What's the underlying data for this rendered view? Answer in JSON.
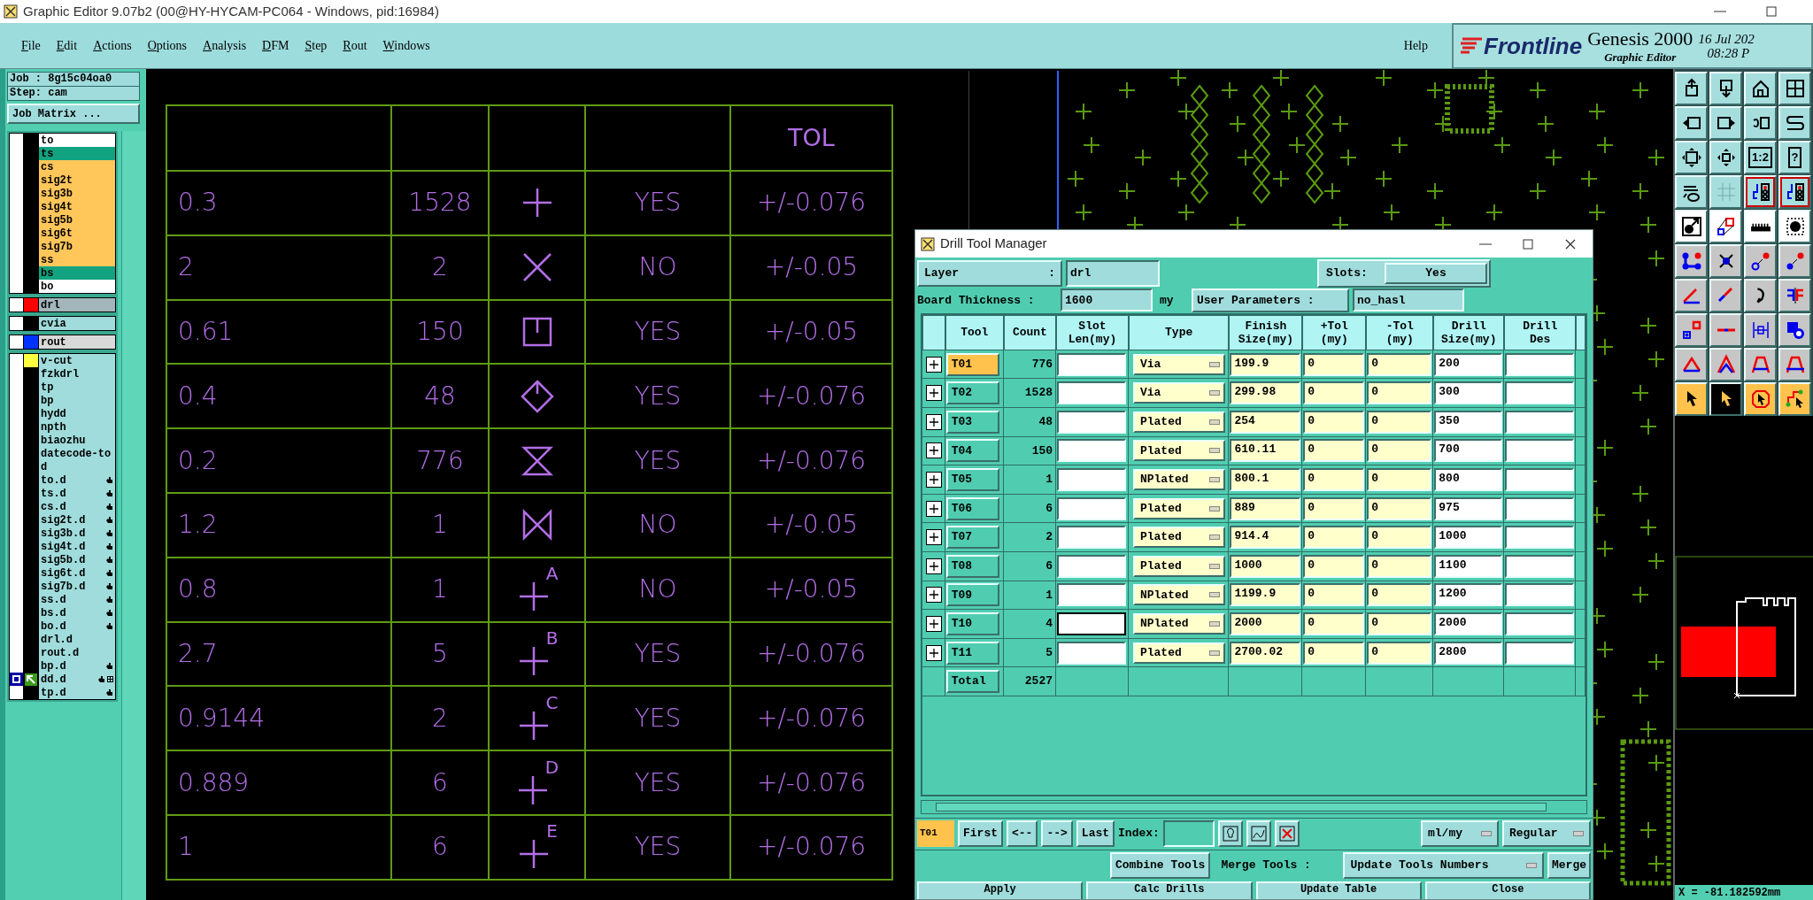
{
  "window": {
    "title": "Graphic Editor 9.07b2 (00@HY-HYCAM-PC064 - Windows, pid:16984)"
  },
  "menu": [
    "File",
    "Edit",
    "Actions",
    "Options",
    "Analysis",
    "DFM",
    "Step",
    "Rout",
    "Windows"
  ],
  "help": "Help",
  "brand": {
    "logo": "Frontline",
    "product": "Genesis 2000",
    "subtitle": "Graphic Editor",
    "date": "16 Jul 202",
    "time": "08:28 P"
  },
  "job": {
    "job": "Job : 8g15c04oa0",
    "step": "Step: cam",
    "matrix_button": "Job Matrix ..."
  },
  "layer_groups": [
    [
      {
        "name": "to",
        "color": "#ffffff",
        "checked": false,
        "marked": false,
        "work": false
      },
      {
        "name": "ts",
        "color": "#11a37f",
        "checked": false,
        "marked": false,
        "work": false
      },
      {
        "name": "cs",
        "color": "#ffc65a",
        "checked": false,
        "marked": false,
        "work": false
      },
      {
        "name": "sig2t",
        "color": "#ffc65a",
        "checked": false,
        "marked": false,
        "work": false
      },
      {
        "name": "sig3b",
        "color": "#ffc65a",
        "checked": false,
        "marked": false,
        "work": false
      },
      {
        "name": "sig4t",
        "color": "#ffc65a",
        "checked": false,
        "marked": false,
        "work": false
      },
      {
        "name": "sig5b",
        "color": "#ffc65a",
        "checked": false,
        "marked": false,
        "work": false
      },
      {
        "name": "sig6t",
        "color": "#ffc65a",
        "checked": false,
        "marked": false,
        "work": false
      },
      {
        "name": "sig7b",
        "color": "#ffc65a",
        "checked": false,
        "marked": false,
        "work": false
      },
      {
        "name": "ss",
        "color": "#ffc65a",
        "checked": false,
        "marked": false,
        "work": false
      },
      {
        "name": "bs",
        "color": "#11a37f",
        "checked": false,
        "marked": false,
        "work": false
      },
      {
        "name": "bo",
        "color": "#ffffff",
        "checked": false,
        "marked": false,
        "work": false
      }
    ],
    [
      {
        "name": "drl",
        "color": "#a3b6bb",
        "swatch": {
          "color": "#ff0000"
        },
        "checked": false,
        "marked": false,
        "work": false
      }
    ],
    [
      {
        "name": "cvia",
        "color": "#a0dcdc",
        "checked": false,
        "marked": false,
        "work": false
      }
    ],
    [
      {
        "name": "rout",
        "color": "#d9d9d9",
        "swatch": {
          "color": "#0033ff"
        },
        "checked": false,
        "marked": false,
        "work": false
      }
    ],
    [
      {
        "name": "v-cut",
        "color": "#a0dcdc",
        "swatch": {
          "color": "#ffff40"
        },
        "checked": false,
        "marked": false,
        "work": false
      },
      {
        "name": "fzkdrl",
        "color": "#a0dcdc",
        "checked": false,
        "marked": false,
        "work": false
      },
      {
        "name": "tp",
        "color": "#a0dcdc",
        "checked": false,
        "marked": false,
        "work": false
      },
      {
        "name": "bp",
        "color": "#a0dcdc",
        "checked": false,
        "marked": false,
        "work": false
      },
      {
        "name": "hydd",
        "color": "#a0dcdc",
        "checked": false,
        "marked": false,
        "work": false
      },
      {
        "name": "npth",
        "color": "#a0dcdc",
        "checked": false,
        "marked": false,
        "work": false
      },
      {
        "name": "biaozhu",
        "color": "#a0dcdc",
        "checked": false,
        "marked": false,
        "work": false
      },
      {
        "name": "datecode-to",
        "color": "#a0dcdc",
        "checked": false,
        "marked": false,
        "work": false
      },
      {
        "name": "d",
        "color": "#a0dcdc",
        "checked": false,
        "marked": false,
        "work": false
      },
      {
        "name": "to.d",
        "color": "#a0dcdc",
        "checked": false,
        "marked": true,
        "work": false
      },
      {
        "name": "ts.d",
        "color": "#a0dcdc",
        "checked": false,
        "marked": true,
        "work": false
      },
      {
        "name": "cs.d",
        "color": "#a0dcdc",
        "checked": false,
        "marked": true,
        "work": false
      },
      {
        "name": "sig2t.d",
        "color": "#a0dcdc",
        "checked": false,
        "marked": true,
        "work": false
      },
      {
        "name": "sig3b.d",
        "color": "#a0dcdc",
        "checked": false,
        "marked": true,
        "work": false
      },
      {
        "name": "sig4t.d",
        "color": "#a0dcdc",
        "checked": false,
        "marked": true,
        "work": false
      },
      {
        "name": "sig5b.d",
        "color": "#a0dcdc",
        "checked": false,
        "marked": true,
        "work": false
      },
      {
        "name": "sig6t.d",
        "color": "#a0dcdc",
        "checked": false,
        "marked": true,
        "work": false
      },
      {
        "name": "sig7b.d",
        "color": "#a0dcdc",
        "checked": false,
        "marked": true,
        "work": false
      },
      {
        "name": "ss.d",
        "color": "#a0dcdc",
        "checked": false,
        "marked": true,
        "work": false
      },
      {
        "name": "bs.d",
        "color": "#a0dcdc",
        "checked": false,
        "marked": true,
        "work": false
      },
      {
        "name": "bo.d",
        "color": "#a0dcdc",
        "checked": false,
        "marked": true,
        "work": false
      },
      {
        "name": "drl.d",
        "color": "#a0dcdc",
        "checked": false,
        "marked": false,
        "work": false
      },
      {
        "name": "rout.d",
        "color": "#a0dcdc",
        "checked": false,
        "marked": false,
        "work": false
      },
      {
        "name": "bp.d",
        "color": "#a0dcdc",
        "checked": false,
        "marked": true,
        "work": false
      },
      {
        "name": "dd.d",
        "color": "#a0dcdc",
        "checked": true,
        "marked": true,
        "work": true
      },
      {
        "name": "tp.d",
        "color": "#a0dcdc",
        "checked": false,
        "marked": true,
        "work": false
      }
    ]
  ],
  "drill_table": {
    "tol_header": "TOL",
    "rows": [
      {
        "size": "0.3",
        "count": "1528",
        "kind": "plus",
        "plated": "YES",
        "tol": "+/-0.076"
      },
      {
        "size": "2",
        "count": "2",
        "kind": "cross",
        "plated": "NO",
        "tol": "+/-0.05"
      },
      {
        "size": "0.61",
        "count": "150",
        "kind": "square",
        "plated": "YES",
        "tol": "+/-0.05"
      },
      {
        "size": "0.4",
        "count": "48",
        "kind": "diamond",
        "plated": "YES",
        "tol": "+/-0.076"
      },
      {
        "size": "0.2",
        "count": "776",
        "kind": "hourglass",
        "plated": "YES",
        "tol": "+/-0.076"
      },
      {
        "size": "1.2",
        "count": "1",
        "kind": "bowtie",
        "plated": "NO",
        "tol": "+/-0.05"
      },
      {
        "size": "0.8",
        "count": "1",
        "kind": "plus",
        "letter": "A",
        "plated": "NO",
        "tol": "+/-0.05"
      },
      {
        "size": "2.7",
        "count": "5",
        "kind": "plus",
        "letter": "B",
        "plated": "YES",
        "tol": "+/-0.076"
      },
      {
        "size": "0.9144",
        "count": "2",
        "kind": "plus",
        "letter": "C",
        "plated": "YES",
        "tol": "+/-0.076"
      },
      {
        "size": "0.889",
        "count": "6",
        "kind": "plus",
        "letter": "D",
        "plated": "YES",
        "tol": "+/-0.076"
      },
      {
        "size": "1",
        "count": "6",
        "kind": "plus",
        "letter": "E",
        "plated": "YES",
        "tol": "+/-0.076"
      }
    ]
  },
  "toolbar": {
    "glyphs": [
      "1:2",
      "?"
    ],
    "select_modes": [
      {
        "selected": false
      },
      {
        "selected": true
      },
      {
        "selected": false
      },
      {
        "selected": false
      }
    ]
  },
  "status": "X = -81.182592mm",
  "dialog": {
    "title": "Drill Tool Manager",
    "layer_label": "Layer",
    "layer_colon": ":",
    "layer": "drl",
    "slots_label": "Slots:",
    "slots": "Yes",
    "thickness_label": "Board Thickness :",
    "thickness": "1600",
    "thickness_unit": "my",
    "user_params_button": "User Parameters :",
    "user_params": "no_hasl",
    "columns": [
      "Tool",
      "Count",
      "Slot\nLen(my)",
      "Type",
      "Finish\nSize(my)",
      "+Tol\n(my)",
      "-Tol\n(my)",
      "Drill\nSize(my)",
      "Drill\nDes"
    ],
    "rows": [
      {
        "tool": "T01",
        "count": "776",
        "type": "Via",
        "finish": "199.9",
        "plus_tol": "0",
        "minus_tol": "0",
        "drill_size": "200",
        "selected": true,
        "slot_focused": false
      },
      {
        "tool": "T02",
        "count": "1528",
        "type": "Via",
        "finish": "299.98",
        "plus_tol": "0",
        "minus_tol": "0",
        "drill_size": "300",
        "selected": false,
        "slot_focused": false
      },
      {
        "tool": "T03",
        "count": "48",
        "type": "Plated",
        "finish": "254",
        "plus_tol": "0",
        "minus_tol": "0",
        "drill_size": "350",
        "selected": false,
        "slot_focused": false
      },
      {
        "tool": "T04",
        "count": "150",
        "type": "Plated",
        "finish": "610.11",
        "plus_tol": "0",
        "minus_tol": "0",
        "drill_size": "700",
        "selected": false,
        "slot_focused": false
      },
      {
        "tool": "T05",
        "count": "1",
        "type": "NPlated",
        "finish": "800.1",
        "plus_tol": "0",
        "minus_tol": "0",
        "drill_size": "800",
        "selected": false,
        "slot_focused": false
      },
      {
        "tool": "T06",
        "count": "6",
        "type": "Plated",
        "finish": "889",
        "plus_tol": "0",
        "minus_tol": "0",
        "drill_size": "975",
        "selected": false,
        "slot_focused": false
      },
      {
        "tool": "T07",
        "count": "2",
        "type": "Plated",
        "finish": "914.4",
        "plus_tol": "0",
        "minus_tol": "0",
        "drill_size": "1000",
        "selected": false,
        "slot_focused": false
      },
      {
        "tool": "T08",
        "count": "6",
        "type": "Plated",
        "finish": "1000",
        "plus_tol": "0",
        "minus_tol": "0",
        "drill_size": "1100",
        "selected": false,
        "slot_focused": false
      },
      {
        "tool": "T09",
        "count": "1",
        "type": "NPlated",
        "finish": "1199.9",
        "plus_tol": "0",
        "minus_tol": "0",
        "drill_size": "1200",
        "selected": false,
        "slot_focused": false
      },
      {
        "tool": "T10",
        "count": "4",
        "type": "NPlated",
        "finish": "2000",
        "plus_tol": "0",
        "minus_tol": "0",
        "drill_size": "2000",
        "selected": false,
        "slot_focused": true
      },
      {
        "tool": "T11",
        "count": "5",
        "type": "Plated",
        "finish": "2700.02",
        "plus_tol": "0",
        "minus_tol": "0",
        "drill_size": "2800",
        "selected": false,
        "slot_focused": false
      }
    ],
    "total_label": "Total",
    "total": "2527",
    "current_tool": "T01",
    "nav": [
      "First",
      "<--",
      "-->",
      "Last"
    ],
    "index_label": "Index:",
    "units": "ml/my",
    "mode": "Regular",
    "combine_button": "Combine Tools",
    "merge_label": "Merge Tools :",
    "merge_option": "Update Tools Numbers",
    "merge_button": "Merge",
    "actions": [
      "Apply",
      "Calc Drills",
      "Update Table",
      "Close"
    ]
  }
}
